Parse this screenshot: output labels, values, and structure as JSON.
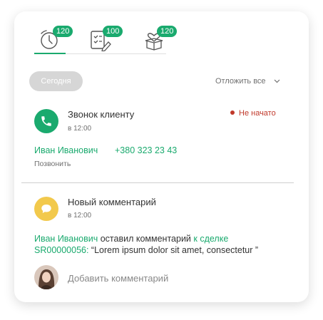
{
  "tabs": [
    {
      "icon": "clock-icon",
      "badge": "120",
      "active": true
    },
    {
      "icon": "checklist-edit-icon",
      "badge": "100",
      "active": false
    },
    {
      "icon": "gift-box-heart-icon",
      "badge": "120",
      "active": false
    }
  ],
  "filter": {
    "today_label": "Сегодня",
    "postpone_label": "Отложить все"
  },
  "task1": {
    "icon": "phone-icon",
    "title": "Звонок клиенту",
    "time": "в 12:00",
    "status": "Не начато",
    "contact_name": "Иван Иванович",
    "phone": "+380 323 23 43",
    "action": "Позвонить"
  },
  "task2": {
    "icon": "chat-bubble-icon",
    "title": "Новый комментарий",
    "time": "в 12:00",
    "author": "Иван Иванович",
    "middle": " оставил комментарий ",
    "deal_link": "к сделке SR00000056:",
    "quote": " “Lorem ipsum dolor sit amet, consectetur ”",
    "add_comment": "Добавить комментарий"
  },
  "colors": {
    "accent": "#1aaa6e",
    "status_red": "#c0392b",
    "comment_yellow": "#f2c94c"
  }
}
